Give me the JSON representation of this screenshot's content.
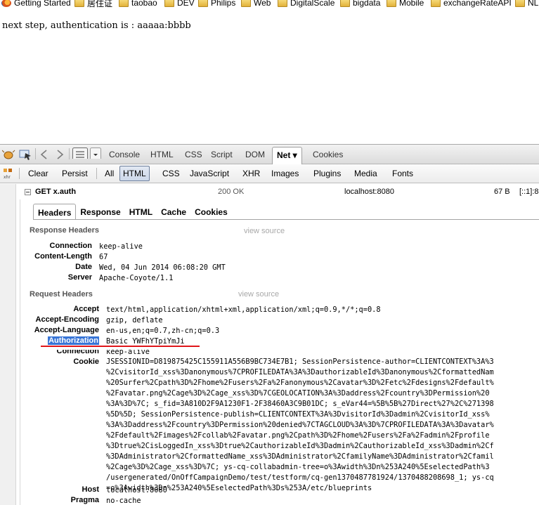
{
  "bookmarks": [
    {
      "label": "Getting Started",
      "icon": "firefox-icon"
    },
    {
      "label": "居住证",
      "icon": "folder-icon"
    },
    {
      "label": "taobao",
      "icon": "folder-icon"
    },
    {
      "label": "DEV",
      "icon": "folder-icon"
    },
    {
      "label": "Philips",
      "icon": "folder-icon"
    },
    {
      "label": "Web",
      "icon": "folder-icon"
    },
    {
      "label": "DigitalScale",
      "icon": "folder-icon"
    },
    {
      "label": "bigdata",
      "icon": "folder-icon"
    },
    {
      "label": "Mobile",
      "icon": "folder-icon"
    },
    {
      "label": "exchangeRateAPI",
      "icon": "folder-icon"
    },
    {
      "label": "NL",
      "icon": "folder-icon"
    }
  ],
  "page": {
    "message": "next step, authentication is : aaaaa:bbbb"
  },
  "firebug": {
    "tabs": [
      "Console",
      "HTML",
      "CSS",
      "Script",
      "DOM",
      "Net ▾",
      "Cookies"
    ],
    "selected_tab": "Net ▾"
  },
  "net_toolbar": {
    "buttons": [
      "Clear",
      "Persist",
      "All",
      "HTML",
      "CSS",
      "JavaScript",
      "XHR",
      "Images",
      "Plugins",
      "Media",
      "Fonts"
    ],
    "selected": "HTML"
  },
  "request": {
    "method_url": "GET x.auth",
    "status": "200 OK",
    "domain": "localhost:8080",
    "size": "67 B",
    "remote": "[::1]:8"
  },
  "info_tabs": [
    "Headers",
    "Response",
    "HTML",
    "Cache",
    "Cookies"
  ],
  "response_headers": {
    "title": "Response Headers",
    "view_source": "view source",
    "items": [
      {
        "name": "Connection",
        "value": "keep-alive"
      },
      {
        "name": "Content-Length",
        "value": "67"
      },
      {
        "name": "Date",
        "value": "Wed, 04 Jun 2014 06:08:20 GMT"
      },
      {
        "name": "Server",
        "value": "Apache-Coyote/1.1"
      }
    ]
  },
  "request_headers": {
    "title": "Request Headers",
    "view_source": "view source",
    "items": [
      {
        "name": "Accept",
        "value": "text/html,application/xhtml+xml,application/xml;q=0.9,*/*;q=0.8"
      },
      {
        "name": "Accept-Encoding",
        "value": "gzip, deflate"
      },
      {
        "name": "Accept-Language",
        "value": "en-us,en;q=0.7,zh-cn;q=0.3"
      },
      {
        "name": "Authorization",
        "value": "Basic YWFhYTpiYmJi"
      },
      {
        "name": "Connection",
        "value": "keep-alive"
      }
    ],
    "cookie_name": "Cookie",
    "cookie_lines": [
      "JSESSIONID=D819875425C155911A556B9BC734E7B1; SessionPersistence-author=CLIENTCONTEXT%3A%3",
      "%2CvisitorId_xss%3Danonymous%7CPROFILEDATA%3A%3DauthorizableId%3Danonymous%2CformattedNam",
      "%20Surfer%2Cpath%3D%2Fhome%2Fusers%2Fa%2Fanonymous%2Cavatar%3D%2Fetc%2Fdesigns%2Fdefault%",
      "%2Favatar.png%2Cage%3D%2Cage_xss%3D%7CGEOLOCATION%3A%3Daddress%2Fcountry%3DPermission%20",
      "%3A%3D%7C; s_fid=3A810D2F9A1230F1-2F38460A3C9B01DC; s_eVar44=%5B%5B%27Direct%27%2C%271398",
      "%5D%5D; SessionPersistence-publish=CLIENTCONTEXT%3A%3DvisitorId%3Dadmin%2CvisitorId_xss%",
      "%3A%3Daddress%2Fcountry%3DPermission%20denied%7CTAGCLOUD%3A%3D%7CPROFILEDATA%3A%3Davatar%",
      "%2Fdefault%2Fimages%2Fcollab%2Favatar.png%2Cpath%3D%2Fhome%2Fusers%2Fa%2Fadmin%2Fprofile",
      "%3Dtrue%2CisLoggedIn_xss%3Dtrue%2CauthorizableId%3Dadmin%2CauthorizableId_xss%3Dadmin%2Cf",
      "%3DAdministrator%2CformattedName_xss%3DAdministrator%2CfamilyName%3DAdministrator%2Cfamil",
      "%2Cage%3D%2Cage_xss%3D%7C; ys-cq-collabadmin-tree=o%3Awidth%3Dn%253A240%5EselectedPath%3",
      "/usergenerated/OnOffCampaignDemo/test/testform/cq-gen1370487781924/1370488208698_1; ys-cq",
      "=o%3Awidth%3Dn%253A240%5EselectedPath%3Ds%253A/etc/blueprints"
    ],
    "tail_items": [
      {
        "name": "Host",
        "value": "localhost:8080"
      },
      {
        "name": "Pragma",
        "value": "no-cache"
      }
    ]
  }
}
